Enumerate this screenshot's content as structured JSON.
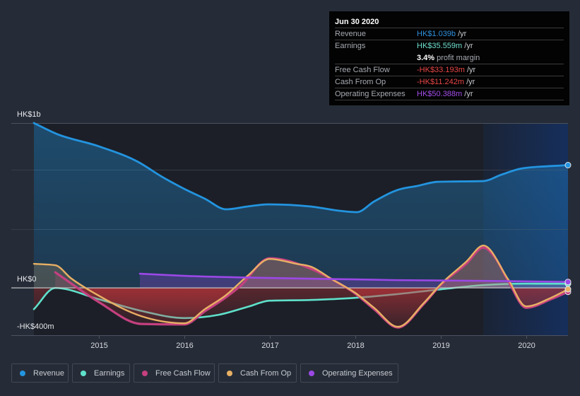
{
  "tooltip": {
    "date": "Jun 30 2020",
    "revenue": {
      "label": "Revenue",
      "value": "HK$1.039b",
      "unit": "/yr",
      "color": "#2e8fdc"
    },
    "earnings": {
      "label": "Earnings",
      "value": "HK$35.559m",
      "unit": "/yr",
      "color": "#6fe0cf",
      "margin_value": "3.4%",
      "margin_label": "profit margin"
    },
    "free_cash_flow": {
      "label": "Free Cash Flow",
      "value": "-HK$33.193m",
      "unit": "/yr",
      "color": "#e84545"
    },
    "cash_from_op": {
      "label": "Cash From Op",
      "value": "-HK$11.242m",
      "unit": "/yr",
      "color": "#e84545"
    },
    "operating_expenses": {
      "label": "Operating Expenses",
      "value": "HK$50.388m",
      "unit": "/yr",
      "color": "#a24de8"
    }
  },
  "legend": [
    {
      "label": "Revenue",
      "color": "#2394df"
    },
    {
      "label": "Earnings",
      "color": "#5fe0cb"
    },
    {
      "label": "Free Cash Flow",
      "color": "#c4407f"
    },
    {
      "label": "Cash From Op",
      "color": "#e8b064"
    },
    {
      "label": "Operating Expenses",
      "color": "#9b48e6"
    }
  ],
  "chart_data": {
    "type": "area",
    "title": "",
    "xlabel": "",
    "ylabel": "",
    "units": "HK$ millions",
    "xlim": [
      2014.24,
      2020.49
    ],
    "ylim": [
      -400,
      1395
    ],
    "y_labels": [
      {
        "label": "HK$1b",
        "position": "top"
      },
      {
        "label": "HK$0",
        "value": 0
      },
      {
        "label": "-HK$400m",
        "value": -400
      }
    ],
    "gridlines": [
      1000,
      500
    ],
    "grid": true,
    "x_ticks": [
      {
        "value": 2015,
        "label": "2015"
      },
      {
        "value": 2016,
        "label": "2016"
      },
      {
        "value": 2017,
        "label": "2017"
      },
      {
        "value": 2018,
        "label": "2018"
      },
      {
        "value": 2019,
        "label": "2019"
      },
      {
        "value": 2020,
        "label": "2020"
      }
    ],
    "highlight_range": [
      2019.5,
      2020.49
    ],
    "legend_position": "bottom-left",
    "series": [
      {
        "name": "Revenue",
        "key": "revenue",
        "color": "#2394df",
        "fill": "revenue",
        "points": [
          [
            2014.24,
            1395
          ],
          [
            2014.5,
            1305
          ],
          [
            2015.0,
            1198
          ],
          [
            2015.46,
            1066
          ],
          [
            2015.74,
            940
          ],
          [
            2016.0,
            838
          ],
          [
            2016.24,
            755
          ],
          [
            2016.49,
            665
          ],
          [
            2016.74,
            689
          ],
          [
            2016.98,
            707
          ],
          [
            2017.48,
            689
          ],
          [
            2017.81,
            653
          ],
          [
            2018.02,
            641
          ],
          [
            2018.22,
            731
          ],
          [
            2018.51,
            832
          ],
          [
            2018.72,
            862
          ],
          [
            2018.97,
            898
          ],
          [
            2019.5,
            904
          ],
          [
            2019.71,
            958
          ],
          [
            2019.96,
            1012
          ],
          [
            2020.49,
            1039
          ]
        ]
      },
      {
        "name": "Earnings",
        "key": "earnings",
        "color": "#5fe0cb",
        "fill": "signed",
        "points": [
          [
            2014.24,
            -180
          ],
          [
            2014.49,
            0
          ],
          [
            2015.0,
            -96
          ],
          [
            2015.5,
            -195
          ],
          [
            2016.0,
            -255
          ],
          [
            2016.4,
            -228
          ],
          [
            2016.76,
            -156
          ],
          [
            2017.0,
            -108
          ],
          [
            2017.48,
            -102
          ],
          [
            2018.0,
            -84
          ],
          [
            2018.47,
            -54
          ],
          [
            2019.0,
            -12
          ],
          [
            2019.5,
            24
          ],
          [
            2020.0,
            36
          ],
          [
            2020.49,
            35.6
          ]
        ]
      },
      {
        "name": "Free Cash Flow",
        "key": "free-cash-flow",
        "color": "#c4407f",
        "fill": "signed",
        "points": [
          [
            2014.49,
            132
          ],
          [
            2015.0,
            -120
          ],
          [
            2015.5,
            -305
          ],
          [
            2016.0,
            -309
          ],
          [
            2016.24,
            -198
          ],
          [
            2016.49,
            -78
          ],
          [
            2016.65,
            12
          ],
          [
            2017.0,
            251
          ],
          [
            2017.48,
            162
          ],
          [
            2017.73,
            72
          ],
          [
            2018.0,
            -48
          ],
          [
            2018.22,
            -180
          ],
          [
            2018.5,
            -335
          ],
          [
            2018.8,
            -138
          ],
          [
            2019.0,
            24
          ],
          [
            2019.3,
            204
          ],
          [
            2019.5,
            341
          ],
          [
            2019.63,
            263
          ],
          [
            2019.79,
            60
          ],
          [
            2020.0,
            -168
          ],
          [
            2020.29,
            -96
          ],
          [
            2020.49,
            -33.2
          ]
        ]
      },
      {
        "name": "Cash From Op",
        "key": "cash-from-op",
        "color": "#e8b064",
        "fill": "signed",
        "points": [
          [
            2014.24,
            204
          ],
          [
            2014.49,
            192
          ],
          [
            2014.67,
            84
          ],
          [
            2015.0,
            -66
          ],
          [
            2015.5,
            -240
          ],
          [
            2016.0,
            -299
          ],
          [
            2016.24,
            -180
          ],
          [
            2016.49,
            -60
          ],
          [
            2016.74,
            102
          ],
          [
            2017.0,
            245
          ],
          [
            2017.31,
            204
          ],
          [
            2017.48,
            180
          ],
          [
            2017.73,
            72
          ],
          [
            2018.0,
            -42
          ],
          [
            2018.22,
            -168
          ],
          [
            2018.5,
            -329
          ],
          [
            2018.8,
            -130
          ],
          [
            2019.0,
            30
          ],
          [
            2019.3,
            222
          ],
          [
            2019.5,
            359
          ],
          [
            2019.79,
            72
          ],
          [
            2020.0,
            -156
          ],
          [
            2020.29,
            -84
          ],
          [
            2020.49,
            -11.2
          ]
        ]
      },
      {
        "name": "Operating Expenses",
        "key": "operating-expenses",
        "color": "#9b48e6",
        "fill": "opex",
        "points": [
          [
            2015.48,
            120
          ],
          [
            2016.0,
            102
          ],
          [
            2017.0,
            84
          ],
          [
            2018.0,
            72
          ],
          [
            2018.47,
            66
          ],
          [
            2019.5,
            60
          ],
          [
            2020.49,
            50.4
          ]
        ]
      }
    ]
  }
}
